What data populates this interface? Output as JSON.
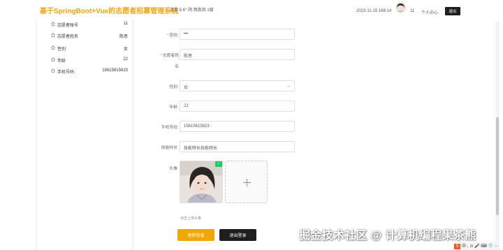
{
  "header": {
    "title": "基于SpringBoot+Vue的志愿者招募管理系统",
    "weather": "北京  8.6°  阴  西南风  1级",
    "datetime": "2023-11-15 166:14",
    "username": "11",
    "user_center": "个人中心",
    "logout_label": "退出"
  },
  "profile": {
    "rows": [
      {
        "icon": "home-icon",
        "label": "志愿者账号",
        "value": "11"
      },
      {
        "icon": "home-icon",
        "label": "志愿者姓名",
        "value": "陈思"
      },
      {
        "icon": "home-icon",
        "label": "性别",
        "value": "女"
      },
      {
        "icon": "home-icon",
        "label": "年龄",
        "value": "22"
      },
      {
        "icon": "home-icon",
        "label": "手机号码",
        "value": "15615615623"
      }
    ]
  },
  "form": {
    "password": {
      "label": "密码",
      "value": "•••",
      "required": true
    },
    "name": {
      "label_line1": "志愿者姓",
      "label_line2": "名",
      "value": "陈思",
      "required": true
    },
    "gender": {
      "label": "性别",
      "value": "女"
    },
    "age": {
      "label": "年龄",
      "value": "22"
    },
    "phone": {
      "label": "手机号码",
      "value": "15615615623"
    },
    "skills": {
      "label": "技能特长",
      "value": "技能特长技能特长"
    },
    "avatar": {
      "label": "头像",
      "tip": "点击上传头像",
      "add_symbol": "+",
      "uploaded": true
    }
  },
  "actions": {
    "update_label": "更新信息",
    "logout_label": "退出登录"
  },
  "overlay": {
    "watermark": "掘金技术社区 @ 计算机编程果茶熊",
    "tray_badge": "S",
    "tray_text": "中·, ⊙ 🎤 ⌨ 👕 ⋯"
  },
  "colors": {
    "accent": "#f0a800",
    "title": "#f1a512",
    "dark_button": "#1e1e1e",
    "required": "#f56c6c",
    "upload_success": "#13ce66"
  }
}
